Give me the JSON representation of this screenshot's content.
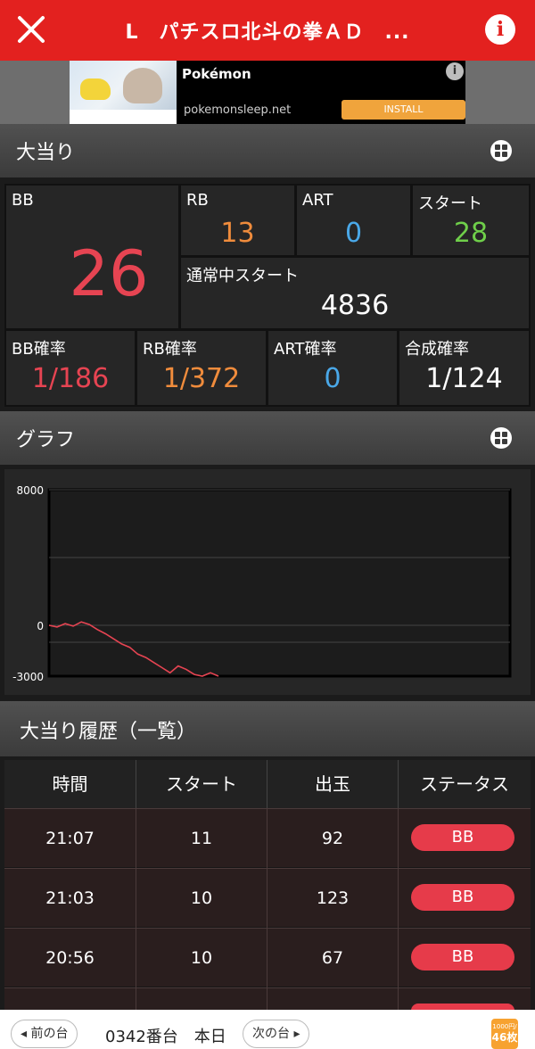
{
  "header": {
    "title": "L　パチスロ北斗の拳ＡＤ　...",
    "info_label": "i"
  },
  "ad": {
    "brand": "Pokémon",
    "url": "pokemonsleep.net",
    "cta": "INSTALL",
    "info": "i"
  },
  "sections": {
    "jackpot": "大当り",
    "graph": "グラフ",
    "history": "大当り履歴（一覧）"
  },
  "stats": {
    "bb_label": "BB",
    "bb_value": "26",
    "rb_label": "RB",
    "rb_value": "13",
    "art_label": "ART",
    "art_value": "0",
    "start_label": "スタート",
    "start_value": "28",
    "normal_start_label": "通常中スタート",
    "normal_start_value": "4836",
    "bb_rate_label": "BB確率",
    "bb_rate_value": "1/186",
    "rb_rate_label": "RB確率",
    "rb_rate_value": "1/372",
    "art_rate_label": "ART確率",
    "art_rate_value": "0",
    "combined_rate_label": "合成確率",
    "combined_rate_value": "1/124"
  },
  "colors": {
    "accent_red": "#e3211f",
    "bb": "#e64452",
    "rb": "#f08c3c",
    "art": "#4aa8e8",
    "start": "#6fcf4a"
  },
  "chart_data": {
    "type": "line",
    "ylim": [
      -3000,
      8000
    ],
    "yticks": [
      "8000",
      "0",
      "-3000"
    ],
    "grid": true,
    "series": [
      {
        "values": [
          0,
          -100,
          100,
          -50,
          200,
          50,
          -250,
          -500,
          -800,
          -1100,
          -1300,
          -1700,
          -1900,
          -2200,
          -2500,
          -2800,
          -2400,
          -2600,
          -2900,
          -3000,
          -2800,
          -3000
        ]
      }
    ]
  },
  "table": {
    "headers": [
      "時間",
      "スタート",
      "出玉",
      "ステータス"
    ],
    "rows": [
      {
        "time": "21:07",
        "start": "11",
        "payout": "92",
        "status": "BB"
      },
      {
        "time": "21:03",
        "start": "10",
        "payout": "123",
        "status": "BB"
      },
      {
        "time": "20:56",
        "start": "10",
        "payout": "67",
        "status": "BB"
      },
      {
        "time": "",
        "start": "",
        "payout": "",
        "status": ""
      }
    ]
  },
  "footer": {
    "prev": "前の台",
    "machine": "0342番台　本日",
    "next": "次の台",
    "coin_top": "1000円/",
    "coin_bottom": "46枚"
  }
}
